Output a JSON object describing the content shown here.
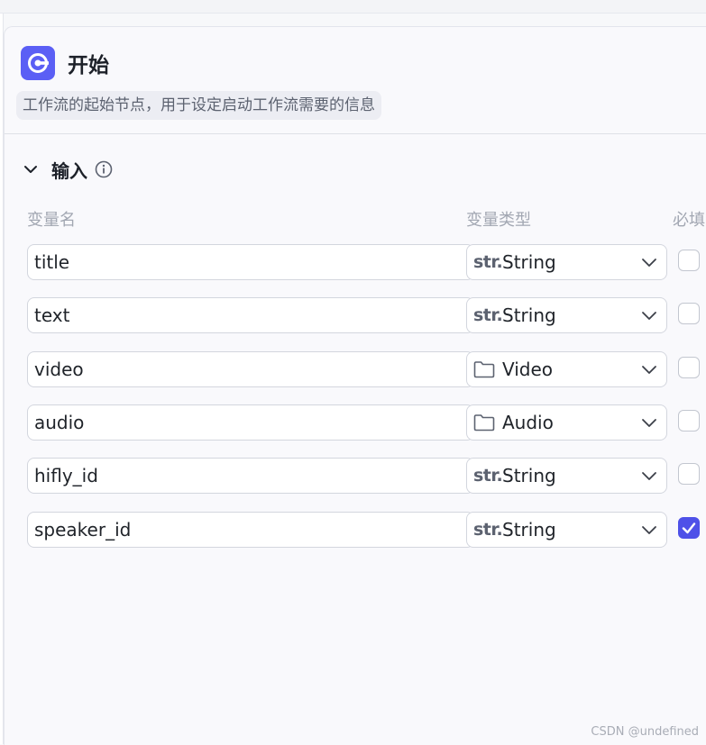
{
  "node": {
    "title": "开始",
    "description": "工作流的起始节点，用于设定启动工作流需要的信息",
    "icon": "start-node-icon",
    "accent_color": "#5b5ff5"
  },
  "section": {
    "title": "输入",
    "info_icon": "info-icon",
    "collapse_icon": "chevron-down-icon"
  },
  "columns": {
    "name": "变量名",
    "type": "变量类型",
    "required": "必填"
  },
  "type_glyphs": {
    "string": "str."
  },
  "variables": [
    {
      "name": "title",
      "type": "String",
      "type_icon": "str-icon",
      "required": false
    },
    {
      "name": "text",
      "type": "String",
      "type_icon": "str-icon",
      "required": false
    },
    {
      "name": "video",
      "type": "Video",
      "type_icon": "folder-icon",
      "required": false
    },
    {
      "name": "audio",
      "type": "Audio",
      "type_icon": "folder-icon",
      "required": false
    },
    {
      "name": "hifly_id",
      "type": "String",
      "type_icon": "str-icon",
      "required": false
    },
    {
      "name": "speaker_id",
      "type": "String",
      "type_icon": "str-icon",
      "required": true
    }
  ],
  "watermark": "CSDN @undefined",
  "colors": {
    "checkbox_checked": "#4e51e8",
    "panel_bg": "#f9f9fc"
  }
}
